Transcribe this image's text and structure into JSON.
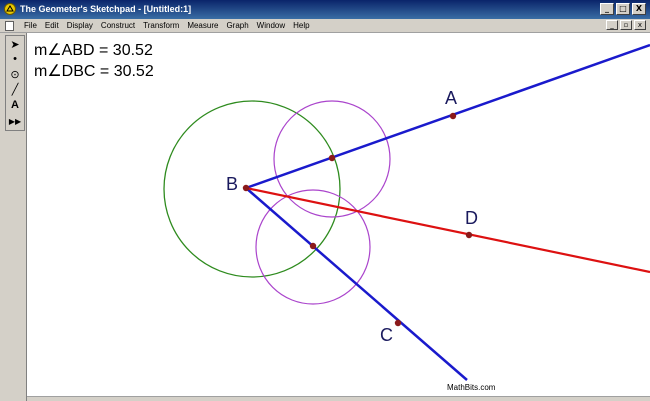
{
  "window": {
    "title": "The Geometer's Sketchpad - [Untitled:1]",
    "buttons": {
      "minimize": "_",
      "maximize": "□",
      "close": "X"
    }
  },
  "menu": {
    "items": [
      "File",
      "Edit",
      "Display",
      "Construct",
      "Transform",
      "Measure",
      "Graph",
      "Window",
      "Help"
    ],
    "doc_buttons": {
      "minimize": "_",
      "restore": "▫",
      "close": "x"
    }
  },
  "toolbox": {
    "tools": [
      {
        "name": "arrow-tool",
        "glyph": "➤"
      },
      {
        "name": "point-tool",
        "glyph": "•"
      },
      {
        "name": "compass-tool",
        "glyph": "⊙"
      },
      {
        "name": "straightedge-tool",
        "glyph": "╱"
      },
      {
        "name": "text-tool",
        "glyph": "A"
      },
      {
        "name": "custom-tool",
        "glyph": "▶▶"
      }
    ]
  },
  "measurements": {
    "abd": "m∠ABD = 30.52",
    "dbc": "m∠DBC = 30.52"
  },
  "points": {
    "a": "A",
    "b": "B",
    "c": "C",
    "d": "D"
  },
  "watermark": "MathBits.com",
  "colors": {
    "ray": "#1a1acc",
    "bisector": "#dd1111",
    "big_circle": "#2e8b1e",
    "small_circle": "#aa44cc",
    "point": "#8b1a1a"
  }
}
